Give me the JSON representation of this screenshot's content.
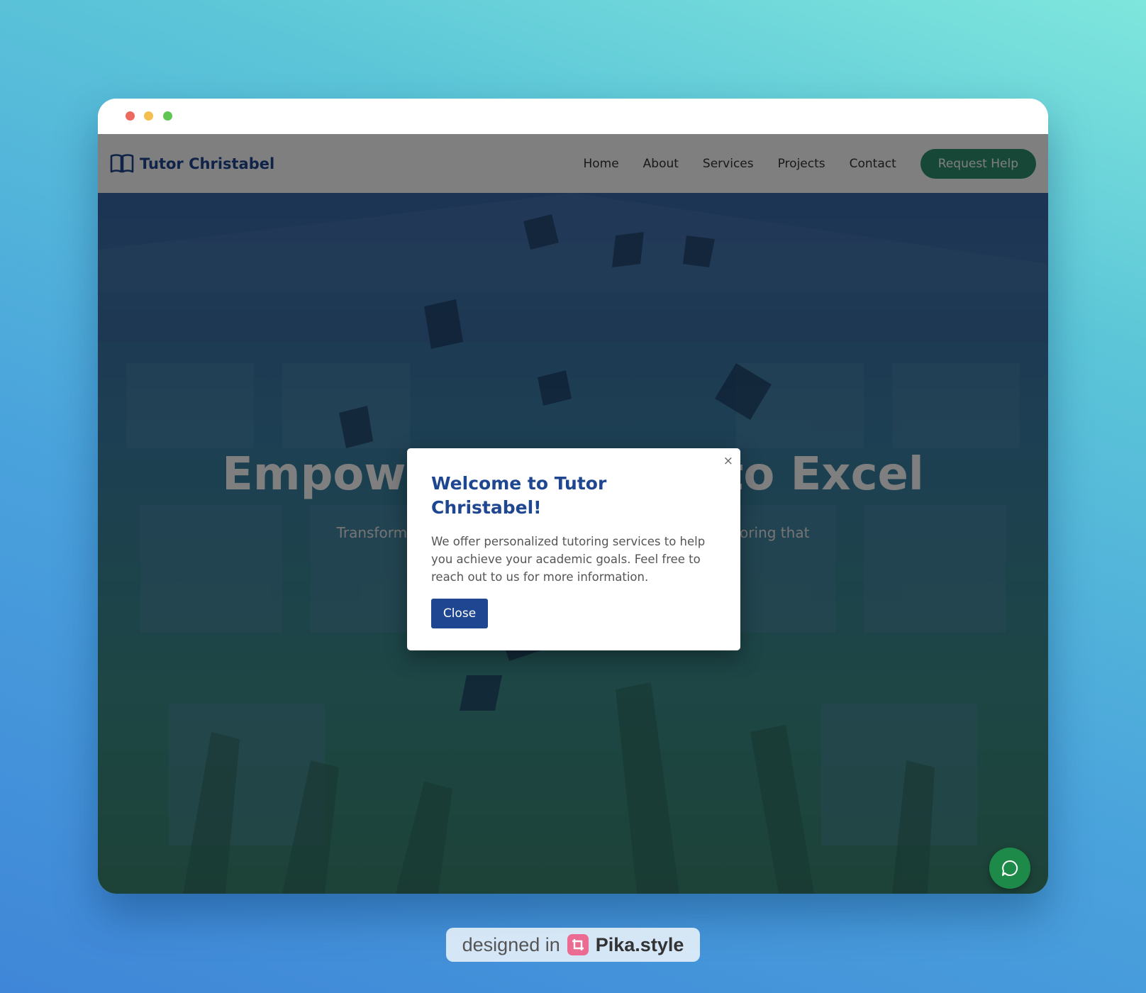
{
  "window": {
    "controls": [
      "close",
      "minimize",
      "maximize"
    ]
  },
  "navbar": {
    "brand": "Tutor Christabel",
    "brand_icon": "book-open-icon",
    "links": [
      {
        "label": "Home"
      },
      {
        "label": "About"
      },
      {
        "label": "Services"
      },
      {
        "label": "Projects"
      },
      {
        "label": "Contact"
      }
    ],
    "cta_label": "Request Help"
  },
  "hero": {
    "title": "Empower Students to Excel",
    "subtitle": "Transform learning experiences through personalized tutoring that"
  },
  "modal": {
    "close_icon": "×",
    "title": "Welcome to Tutor Christabel!",
    "text": "We offer personalized tutoring services to help you achieve your academic goals. Feel free to reach out to us for more information.",
    "button_label": "Close"
  },
  "chat": {
    "icon": "chat-bubble-icon"
  },
  "watermark": {
    "prefix": "designed in",
    "brand": "Pika.style"
  },
  "colors": {
    "brand_blue": "#1f4690",
    "cta_green": "#2e8f6f",
    "chat_green": "#1e8a4a"
  }
}
